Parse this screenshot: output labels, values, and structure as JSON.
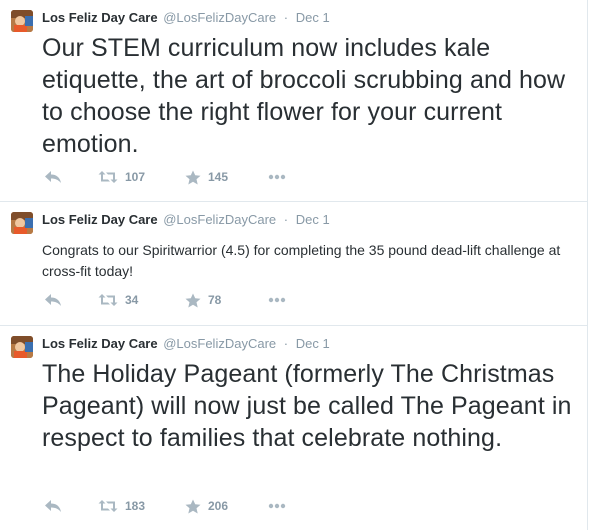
{
  "tweets": [
    {
      "author_name": "Los Feliz Day Care",
      "author_handle": "@LosFelizDayCare",
      "separator": "·",
      "date": "Dec 1",
      "text": "Our STEM curriculum now includes kale etiquette, the art of broccoli scrubbing and how to choose the right flower for your current emotion.",
      "retweets": "107",
      "favorites": "145"
    },
    {
      "author_name": "Los Feliz Day Care",
      "author_handle": "@LosFelizDayCare",
      "separator": "·",
      "date": "Dec 1",
      "text": "Congrats to our Spiritwarrior (4.5) for completing the 35 pound dead-lift challenge at cross-fit today!",
      "retweets": "34",
      "favorites": "78"
    },
    {
      "author_name": "Los Feliz Day Care",
      "author_handle": "@LosFelizDayCare",
      "separator": "·",
      "date": "Dec 1",
      "text": "The Holiday Pageant (formerly The Christmas Pageant) will now just be called The Pageant in respect to families that celebrate nothing.",
      "retweets": "183",
      "favorites": "206"
    }
  ],
  "icons": {
    "reply": "reply-icon",
    "retweet": "retweet-icon",
    "favorite": "star-icon",
    "more": "more-icon"
  },
  "colors": {
    "text": "#292f33",
    "muted": "#8899a6",
    "icon": "#aab8c2",
    "divider": "#e1e8ed"
  }
}
